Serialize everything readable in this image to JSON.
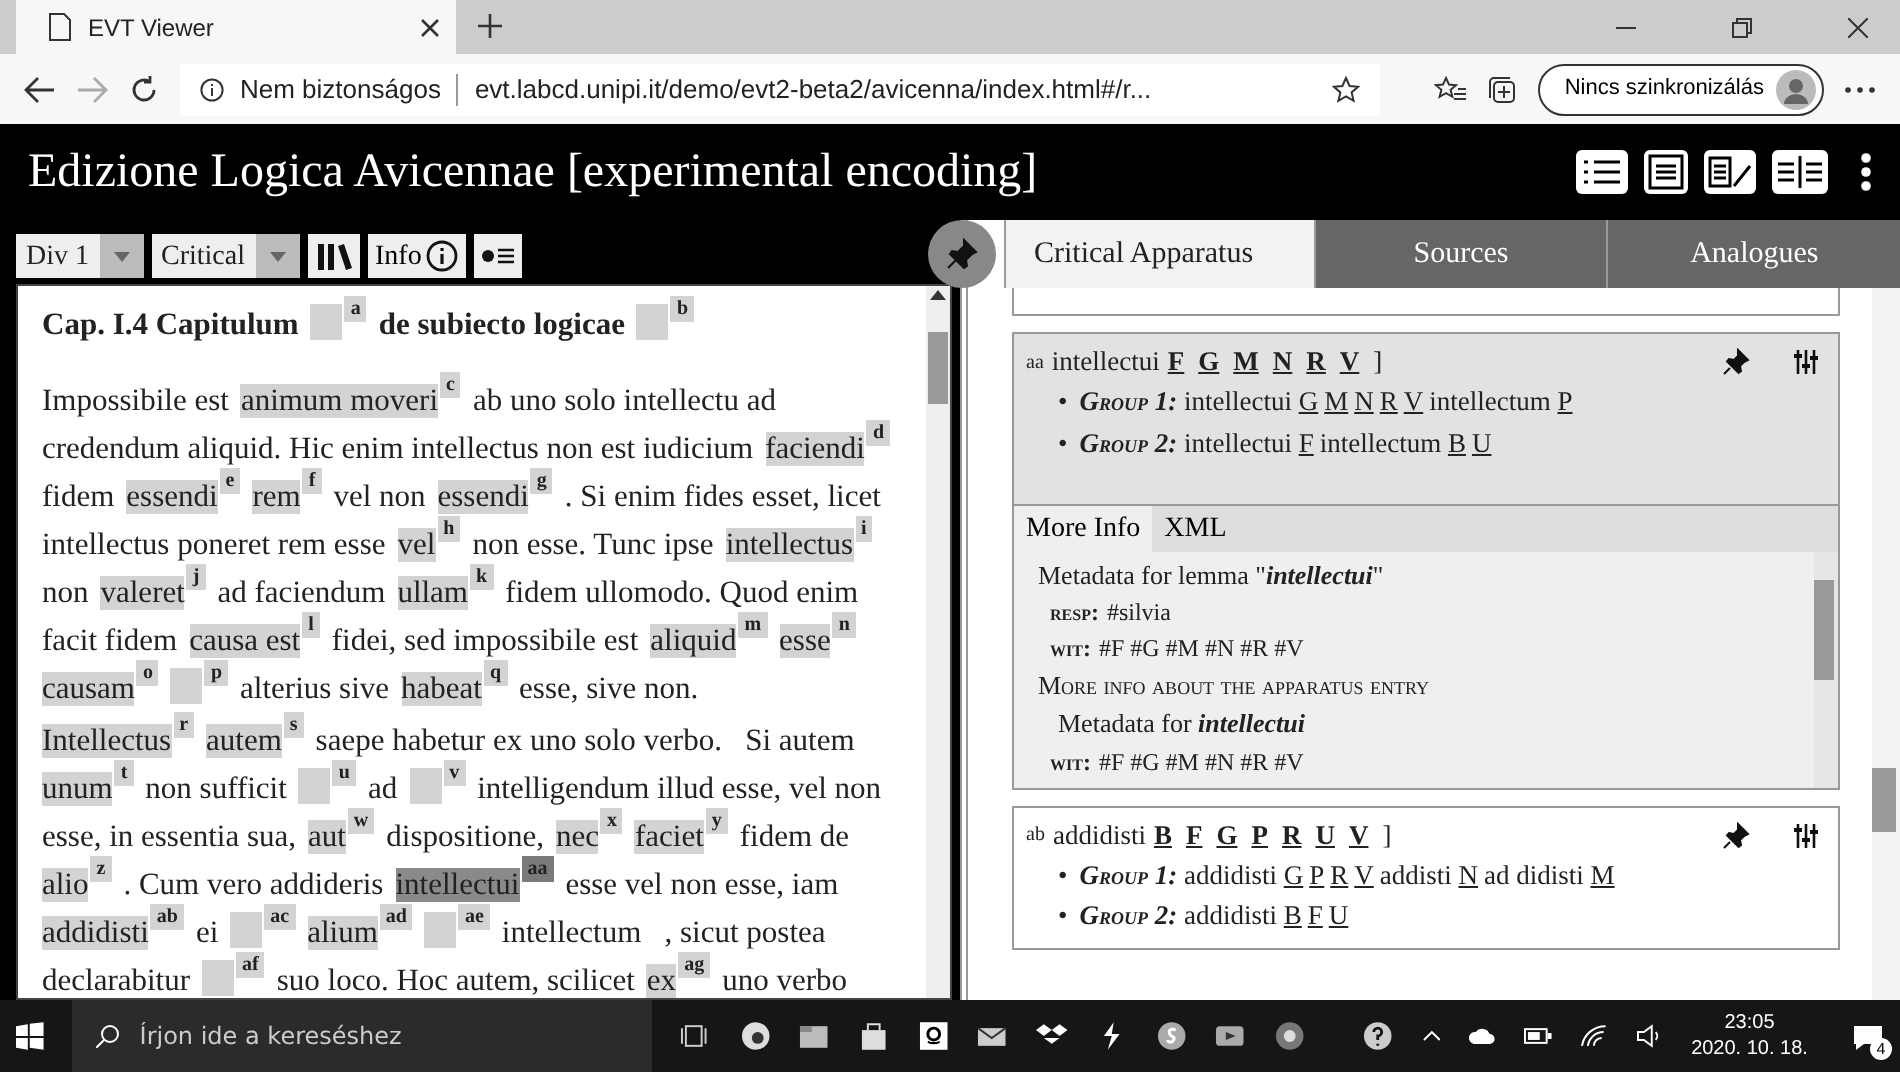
{
  "browser": {
    "tab": {
      "title": "EVT Viewer"
    },
    "security": "Nem biztonságos",
    "url": "evt.labcd.unipi.it/demo/evt2-beta2/avicenna/index.html#/r...",
    "sync": "Nincs szinkronizálás"
  },
  "app": {
    "title": "Edizione Logica Avicennae [experimental encoding]"
  },
  "toolbar": {
    "selects": [
      {
        "value": "Div 1"
      },
      {
        "value": "Critical"
      }
    ],
    "info_button": "Info"
  },
  "text": {
    "heading": [
      {
        "kind": "text",
        "text": "Cap. I.4 Capitulum"
      },
      {
        "kind": "gap",
        "note": "a",
        "selected": false
      },
      {
        "kind": "text",
        "text": "de subiecto logicae"
      },
      {
        "kind": "gap",
        "note": "b",
        "selected": false
      }
    ],
    "paragraphs": [
      [
        [
          {
            "kind": "text",
            "text": "Impossibile est"
          },
          {
            "kind": "lemma",
            "text": "animum moveri",
            "note": "c",
            "selected": false
          },
          {
            "kind": "text",
            "text": "ab uno solo intellectu ad"
          }
        ],
        [
          {
            "kind": "text",
            "text": "credendum aliquid. Hic enim intellectus non est iudicium"
          },
          {
            "kind": "lemma",
            "text": "faciendi",
            "note": "d",
            "selected": false
          }
        ],
        [
          {
            "kind": "text",
            "text": "fidem"
          },
          {
            "kind": "lemma",
            "text": "essendi",
            "note": "e",
            "selected": false
          },
          {
            "kind": "lemma",
            "text": "rem",
            "note": "f",
            "selected": false
          },
          {
            "kind": "text",
            "text": "vel non"
          },
          {
            "kind": "lemma",
            "text": "essendi",
            "note": "g",
            "selected": false
          },
          {
            "kind": "text",
            "text": ". Si enim fides esset, licet"
          }
        ],
        [
          {
            "kind": "text",
            "text": "intellectus poneret rem esse"
          },
          {
            "kind": "lemma",
            "text": "vel",
            "note": "h",
            "selected": false
          },
          {
            "kind": "text",
            "text": "non esse. Tunc ipse"
          },
          {
            "kind": "lemma",
            "text": "intellectus",
            "note": "i",
            "selected": false
          }
        ],
        [
          {
            "kind": "text",
            "text": "non"
          },
          {
            "kind": "lemma",
            "text": "valeret",
            "note": "j",
            "selected": false
          },
          {
            "kind": "text",
            "text": "ad faciendum"
          },
          {
            "kind": "lemma",
            "text": "ullam",
            "note": "k",
            "selected": false
          },
          {
            "kind": "text",
            "text": "fidem ullomodo. Quod enim"
          }
        ],
        [
          {
            "kind": "text",
            "text": "facit fidem"
          },
          {
            "kind": "lemma",
            "text": "causa est",
            "note": "l",
            "selected": false
          },
          {
            "kind": "text",
            "text": "fidei, sed impossibile est"
          },
          {
            "kind": "lemma",
            "text": "aliquid",
            "note": "m",
            "selected": false
          },
          {
            "kind": "lemma",
            "text": "esse",
            "note": "n",
            "selected": false
          }
        ],
        [
          {
            "kind": "lemma",
            "text": "causam",
            "note": "o",
            "selected": false
          },
          {
            "kind": "gap",
            "note": "p",
            "selected": false
          },
          {
            "kind": "text",
            "text": "alterius sive"
          },
          {
            "kind": "lemma",
            "text": "habeat",
            "note": "q",
            "selected": false
          },
          {
            "kind": "text",
            "text": "esse, sive non."
          }
        ]
      ],
      [
        [
          {
            "kind": "lemma",
            "text": "Intellectus",
            "note": "r",
            "selected": false
          },
          {
            "kind": "lemma",
            "text": "autem",
            "note": "s",
            "selected": false
          },
          {
            "kind": "text",
            "text": "saepe habetur ex uno solo verbo.   Si autem"
          }
        ],
        [
          {
            "kind": "lemma",
            "text": "unum",
            "note": "t",
            "selected": false
          },
          {
            "kind": "text",
            "text": "non sufficit"
          },
          {
            "kind": "gap",
            "note": "u",
            "selected": false
          },
          {
            "kind": "text",
            "text": "ad"
          },
          {
            "kind": "gap",
            "note": "v",
            "selected": false
          },
          {
            "kind": "text",
            "text": "intelligendum illud esse, vel non"
          }
        ],
        [
          {
            "kind": "text",
            "text": "esse, in essentia sua,"
          },
          {
            "kind": "lemma",
            "text": "aut",
            "note": "w",
            "selected": false
          },
          {
            "kind": "text",
            "text": "dispositione,"
          },
          {
            "kind": "lemma",
            "text": "nec",
            "note": "x",
            "selected": false
          },
          {
            "kind": "lemma",
            "text": "faciet",
            "note": "y",
            "selected": false
          },
          {
            "kind": "text",
            "text": "fidem de"
          }
        ],
        [
          {
            "kind": "lemma",
            "text": "alio",
            "note": "z",
            "selected": false
          },
          {
            "kind": "text",
            "text": ". Cum vero addideris"
          },
          {
            "kind": "lemma",
            "text": "intellectui",
            "note": "aa",
            "selected": true
          },
          {
            "kind": "text",
            "text": "esse vel non esse, iam"
          }
        ],
        [
          {
            "kind": "lemma",
            "text": "addidisti",
            "note": "ab",
            "selected": false
          },
          {
            "kind": "text",
            "text": "ei"
          },
          {
            "kind": "gap",
            "note": "ac",
            "selected": false
          },
          {
            "kind": "lemma",
            "text": "alium",
            "note": "ad",
            "selected": false
          },
          {
            "kind": "gap",
            "note": "ae",
            "selected": false
          },
          {
            "kind": "text",
            "text": "intellectum   , sicut postea"
          }
        ],
        [
          {
            "kind": "text",
            "text": "declarabitur"
          },
          {
            "kind": "gap",
            "note": "af",
            "selected": false
          },
          {
            "kind": "text",
            "text": "suo loco. Hoc autem, scilicet"
          },
          {
            "kind": "lemma",
            "text": "ex",
            "note": "ag",
            "selected": false
          },
          {
            "kind": "text",
            "text": "uno verbo"
          }
        ]
      ]
    ]
  },
  "apparatus": {
    "tabs": [
      {
        "label": "Critical Apparatus",
        "selected": true
      },
      {
        "label": "Sources",
        "selected": false
      },
      {
        "label": "Analogues",
        "selected": false
      }
    ],
    "entries": [
      {
        "note": "aa",
        "lemma": "intellectui",
        "witnesses": [
          "F",
          "G",
          "M",
          "N",
          "R",
          "V"
        ],
        "bracket": "]",
        "selected": true,
        "groups": [
          {
            "marker": "•",
            "label": "Group 1:",
            "readings": [
              {
                "text": "intellectui",
                "witnesses": [
                  "G",
                  "M",
                  "N",
                  "R",
                  "V"
                ]
              },
              {
                "text": "intellectum",
                "witnesses": [
                  "P"
                ]
              }
            ]
          },
          {
            "marker": "•",
            "label": "Group 2:",
            "readings": [
              {
                "text": "intellectui",
                "witnesses": [
                  "F"
                ]
              },
              {
                "text": "intellectum",
                "witnesses": [
                  "B",
                  "U"
                ]
              }
            ]
          }
        ],
        "details": {
          "tabs": [
            {
              "label": "More Info",
              "selected": true
            },
            {
              "label": "XML",
              "selected": false
            }
          ],
          "lines": [
            {
              "kind": "heading",
              "text": "Metadata for lemma \"**intellectui**\""
            },
            {
              "kind": "field",
              "label": "resp:",
              "value": "#silvia"
            },
            {
              "kind": "field",
              "label": "wit:",
              "value": "#F #G #M #N #R #V"
            },
            {
              "kind": "section",
              "text": "More info about the apparatus entry"
            },
            {
              "kind": "heading",
              "text": "Metadata for **intellectui**"
            },
            {
              "kind": "field",
              "label": "wit:",
              "value": "#F #G #M #N #R #V"
            }
          ]
        }
      },
      {
        "note": "ab",
        "lemma": "addidisti",
        "witnesses": [
          "B",
          "F",
          "G",
          "P",
          "R",
          "U",
          "V"
        ],
        "bracket": "]",
        "selected": false,
        "groups": [
          {
            "marker": "•",
            "label": "Group 1:",
            "readings": [
              {
                "text": "addidisti",
                "witnesses": [
                  "G",
                  "P",
                  "R",
                  "V"
                ]
              },
              {
                "text": "addisti",
                "witnesses": [
                  "N"
                ]
              },
              {
                "text": "ad didisti",
                "witnesses": [
                  "M"
                ]
              }
            ]
          },
          {
            "marker": "•",
            "label": "Group 2:",
            "readings": [
              {
                "text": "addidisti",
                "witnesses": [
                  "B",
                  "F",
                  "U"
                ]
              }
            ]
          }
        ]
      }
    ]
  },
  "taskbar": {
    "search_placeholder": "Írjon ide a kereséshez",
    "time": "23:05",
    "date": "2020. 10. 18.",
    "notifications": "4"
  }
}
